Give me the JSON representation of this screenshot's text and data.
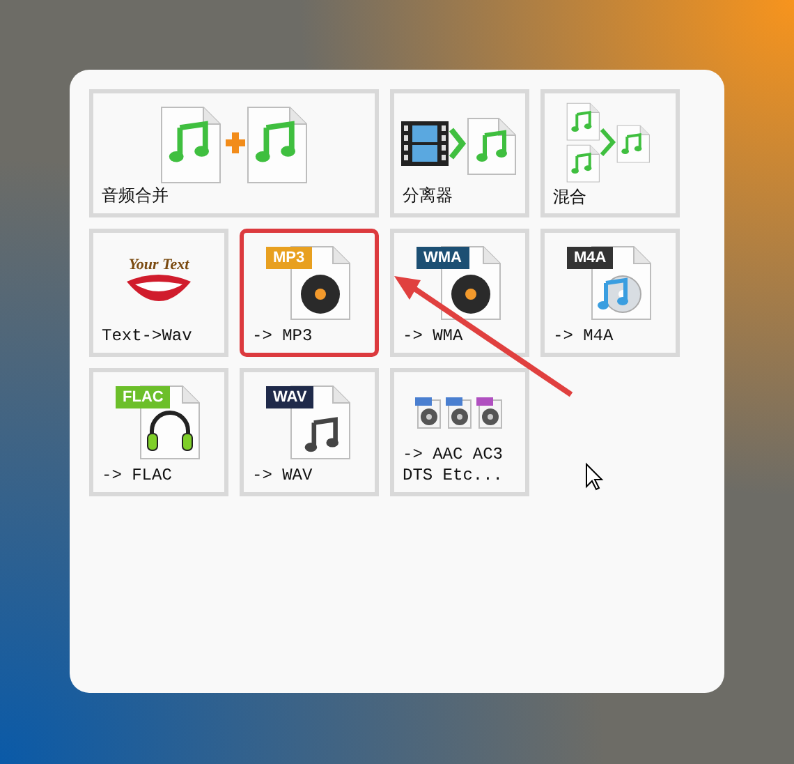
{
  "tiles": [
    {
      "label": "音频合并",
      "kind": "merge",
      "wide": true,
      "highlighted": false
    },
    {
      "label": "分离器",
      "kind": "splitter",
      "wide": false,
      "highlighted": false
    },
    {
      "label": "混合",
      "kind": "mix",
      "wide": false,
      "highlighted": false
    },
    {
      "label": "Text->Wav",
      "kind": "speech",
      "icon_text": "Your Text",
      "wide": false,
      "highlighted": false
    },
    {
      "label": "-> MP3",
      "kind": "disc",
      "badge": "MP3",
      "color": "#e8a020",
      "wide": false,
      "highlighted": true
    },
    {
      "label": "-> WMA",
      "kind": "disc",
      "badge": "WMA",
      "color": "#1c4f73",
      "wide": false,
      "highlighted": false
    },
    {
      "label": "-> M4A",
      "kind": "cd",
      "badge": "M4A",
      "color": "#333333",
      "wide": false,
      "highlighted": false
    },
    {
      "label": "-> FLAC",
      "kind": "headphones",
      "badge": "FLAC",
      "color": "#6cbf2a",
      "wide": false,
      "highlighted": false
    },
    {
      "label": "-> WAV",
      "kind": "notes",
      "badge": "WAV",
      "color": "#1f2a4a",
      "wide": false,
      "highlighted": false
    },
    {
      "label": "-> AAC AC3 DTS Etc...",
      "kind": "multi",
      "wide": false,
      "highlighted": false
    }
  ]
}
